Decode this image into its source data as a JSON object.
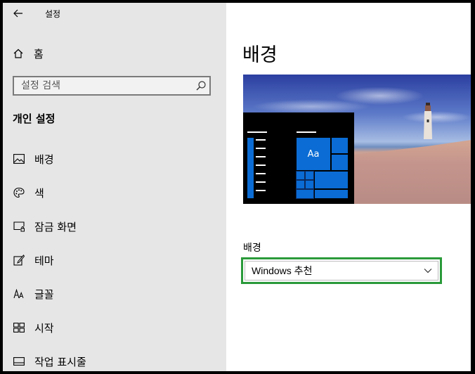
{
  "app": {
    "title": "설정"
  },
  "sidebar": {
    "home_label": "홈",
    "search_placeholder": "설정 검색",
    "section_title": "개인 설정",
    "items": [
      {
        "label": "배경",
        "icon": "picture-icon"
      },
      {
        "label": "색",
        "icon": "palette-icon"
      },
      {
        "label": "잠금 화면",
        "icon": "lock-screen-icon"
      },
      {
        "label": "테마",
        "icon": "theme-brush-icon"
      },
      {
        "label": "글꼴",
        "icon": "font-icon"
      },
      {
        "label": "시작",
        "icon": "start-tiles-icon"
      },
      {
        "label": "작업 표시줄",
        "icon": "taskbar-icon"
      }
    ]
  },
  "main": {
    "title": "배경",
    "preview": {
      "tile_text": "Aa"
    },
    "background_label": "배경",
    "background_value": "Windows 추천"
  },
  "colors": {
    "accent": "#0a6cd4",
    "highlight_border": "#2a9a3a",
    "sidebar_bg": "#e6e6e6"
  }
}
